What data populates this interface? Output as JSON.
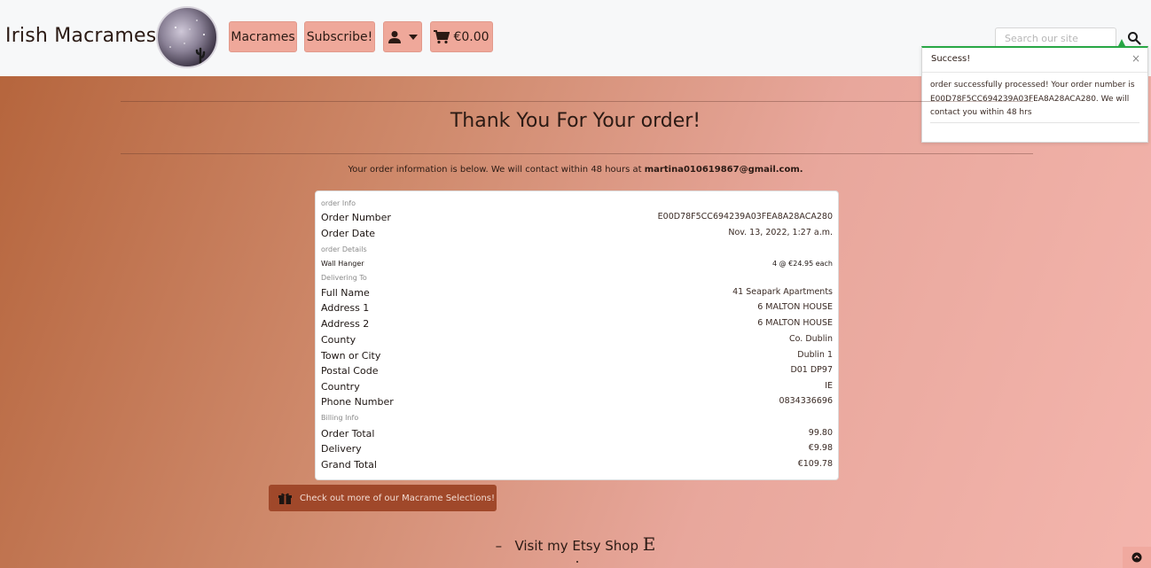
{
  "brand": "Irish Macrames",
  "nav": {
    "macrames": "Macrames",
    "subscribe": "Subscribe!",
    "cart": "€0.00",
    "search_placeholder": "Search our site"
  },
  "toast": {
    "title": "Success!",
    "close": "×",
    "message": "order successfully processed! Your order number is E00D78F5CC694239A03FEA8A28ACA280. We will contact you within 48 hrs"
  },
  "page": {
    "title": "Thank You For Your order!",
    "info_prefix": "Your order information is below. We will contact within 48 hours at",
    "email": "martina010619867@gmail.com."
  },
  "order": {
    "section_info": "order Info",
    "order_number_label": "Order Number",
    "order_number": "E00D78F5CC694239A03FEA8A28ACA280",
    "order_date_label": "Order Date",
    "order_date": "Nov. 13, 2022, 1:27 a.m.",
    "section_details": "order Details",
    "item_name": "Wall Hanger",
    "item_qty": "4 @ €24.95 each",
    "section_delivery": "Delivering To",
    "full_name_label": "Full Name",
    "full_name": "41 Seapark Apartments",
    "address1_label": "Address 1",
    "address1": "6 MALTON HOUSE",
    "address2_label": "Address 2",
    "address2": "6 MALTON HOUSE",
    "county_label": "County",
    "county": "Co. Dublin",
    "town_label": "Town or City",
    "town": "Dublin 1",
    "postal_label": "Postal Code",
    "postal": "D01 DP97",
    "country_label": "Country",
    "country": "IE",
    "phone_label": "Phone Number",
    "phone": "0834336696",
    "section_billing": "Billing Info",
    "order_total_label": "Order Total",
    "order_total": "99.80",
    "delivery_label": "Delivery",
    "delivery": "€9.98",
    "grand_total_label": "Grand Total",
    "grand_total": "€109.78"
  },
  "cta": "Check out more of our Macrame Selections!",
  "etsy": {
    "dash": "–",
    "text": "Visit my Etsy Shop",
    "letter": "E"
  },
  "colors": {
    "accent": "#efa89a",
    "success": "#28a745",
    "cta": "#a0482a"
  }
}
